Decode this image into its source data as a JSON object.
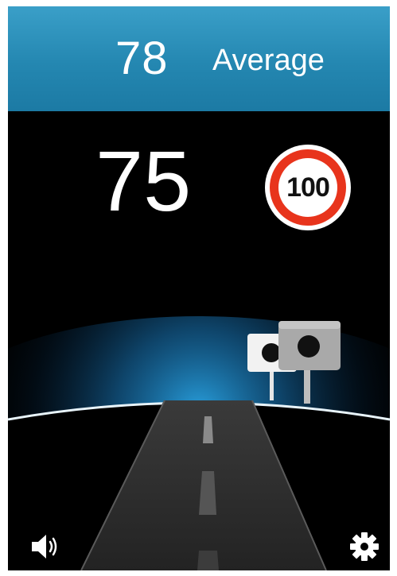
{
  "header": {
    "average_value": "78",
    "average_label": "Average"
  },
  "current": {
    "speed": "75",
    "speed_limit": "100"
  },
  "icons": {
    "volume": "speaker-volume-icon",
    "settings": "gear-icon",
    "camera": "speed-camera-icon"
  },
  "colors": {
    "header_bg": "#2487b1",
    "limit_ring": "#e8341c",
    "horizon_glow": "#2aa6e6",
    "background": "#000000"
  }
}
